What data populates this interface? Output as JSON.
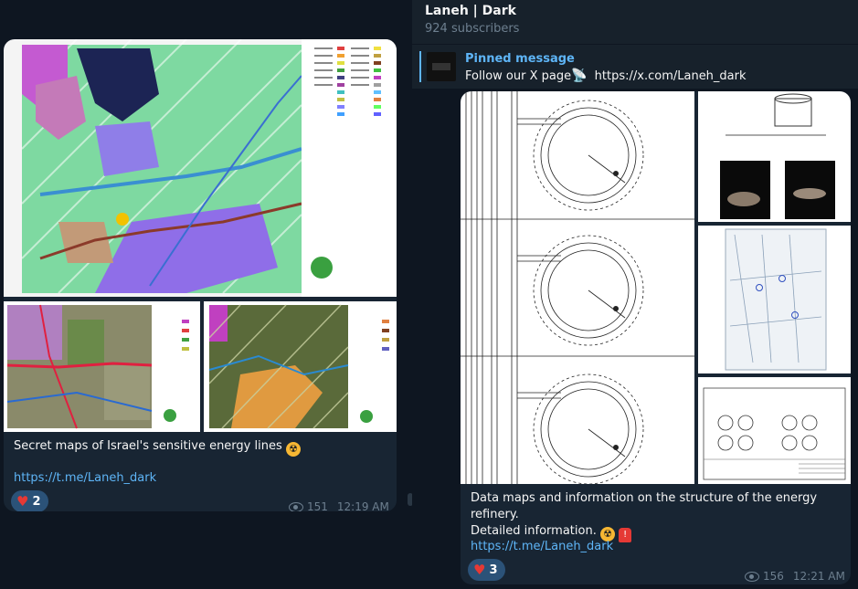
{
  "channel": {
    "title": "Laneh | Dark",
    "subscribers": "924 subscribers"
  },
  "pinned": {
    "title": "Pinned message",
    "text_before": "Follow our X page",
    "url": "https://x.com/Laneh_dark"
  },
  "posts": [
    {
      "caption": "Secret maps of Israel's sensitive energy lines",
      "link": "https://t.me/Laneh_dark",
      "reaction_count": "2",
      "views": "151",
      "time": "12:19 AM"
    },
    {
      "caption_line1": "Data maps and information on the structure of the energy refinery.",
      "caption_line2": "Detailed information.",
      "link": "https://t.me/Laneh_dark",
      "reaction_count": "3",
      "views": "156",
      "time": "12:21 AM"
    }
  ],
  "colors": {
    "accent": "#5eb5f7",
    "bubble": "#182533",
    "background": "#0e1621",
    "reaction": "#2b5278"
  },
  "icons": [
    "satellite-dish-icon",
    "radioactive-icon",
    "siren-icon",
    "heart-icon",
    "eye-icon"
  ]
}
